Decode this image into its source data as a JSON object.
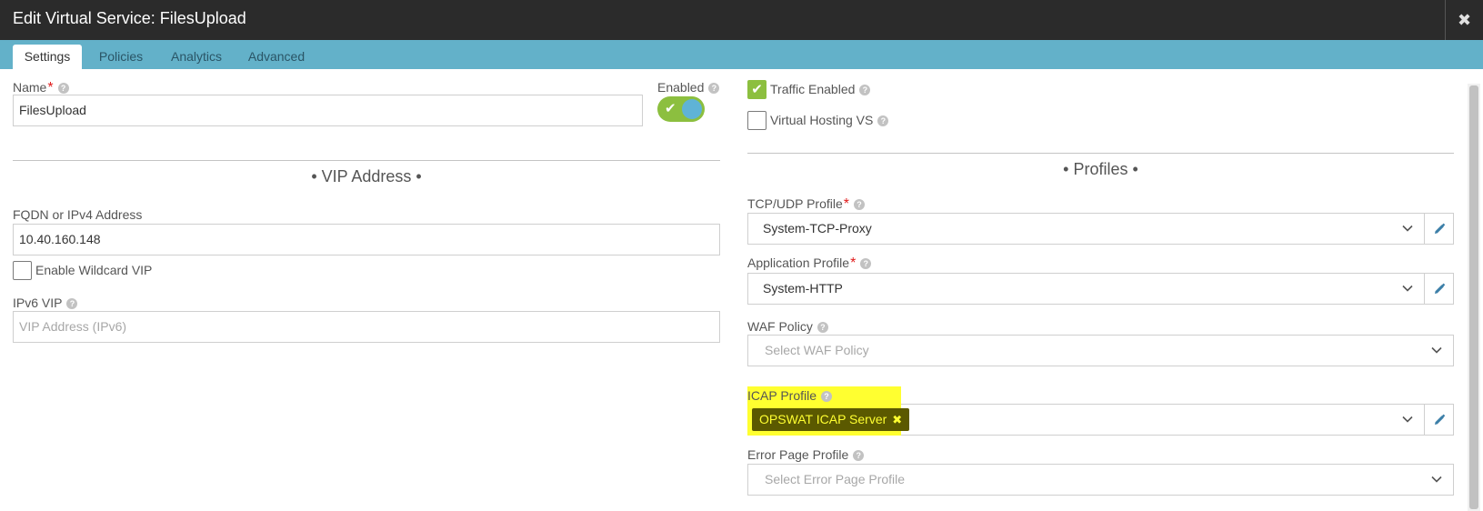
{
  "window": {
    "title": "Edit Virtual Service: FilesUpload",
    "close_glyph": "✖"
  },
  "tabs": [
    {
      "label": "Settings",
      "active": true
    },
    {
      "label": "Policies",
      "active": false
    },
    {
      "label": "Analytics",
      "active": false
    },
    {
      "label": "Advanced",
      "active": false
    }
  ],
  "left": {
    "name_label": "Name",
    "name_value": "FilesUpload",
    "enabled_label": "Enabled",
    "enabled": true,
    "vip_section_title": "• VIP Address •",
    "fqdn_label": "FQDN or IPv4 Address",
    "fqdn_value": "10.40.160.148",
    "wildcard_label": "Enable Wildcard VIP",
    "wildcard_checked": false,
    "ipv6_label": "IPv6 VIP",
    "ipv6_placeholder": "VIP Address (IPv6)"
  },
  "right": {
    "traffic_enabled_label": "Traffic Enabled",
    "traffic_enabled_checked": true,
    "virtual_hosting_label": "Virtual Hosting VS",
    "virtual_hosting_checked": false,
    "profiles_section_title": "• Profiles •",
    "tcp_udp_label": "TCP/UDP Profile",
    "tcp_udp_value": "System-TCP-Proxy",
    "app_profile_label": "Application Profile",
    "app_profile_value": "System-HTTP",
    "waf_label": "WAF Policy",
    "waf_placeholder": "Select WAF Policy",
    "icap_label": "ICAP Profile",
    "icap_tag": "OPSWAT ICAP Server",
    "error_page_label": "Error Page Profile",
    "error_page_placeholder": "Select Error Page Profile"
  },
  "colors": {
    "titlebar": "#2b2b2b",
    "tabbar": "#63b1c9",
    "toggle_on": "#8cbf3f",
    "highlight": "#ffff30",
    "required": "#e01b1b"
  },
  "icons": {
    "help": "?",
    "check": "✔",
    "remove_tag": "✖"
  }
}
